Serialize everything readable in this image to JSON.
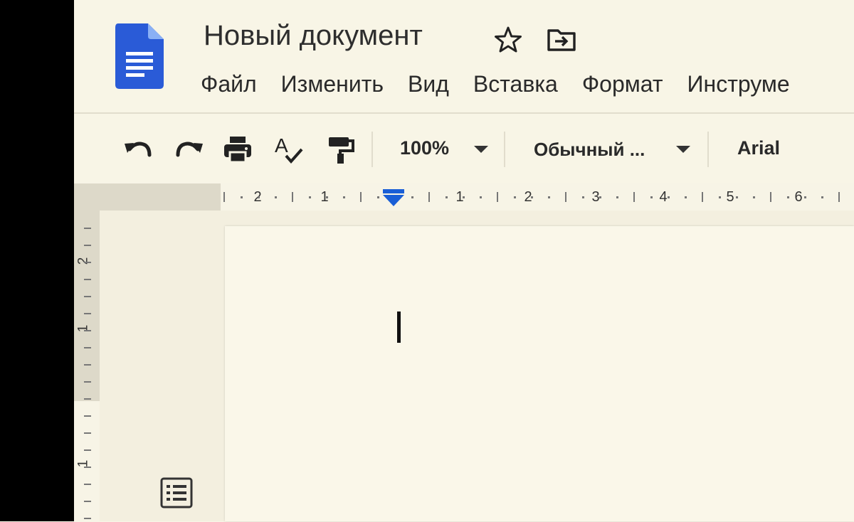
{
  "document": {
    "title": "Новый документ"
  },
  "menu": [
    "Файл",
    "Изменить",
    "Вид",
    "Вставка",
    "Формат",
    "Инструме"
  ],
  "toolbar": {
    "icons": [
      "undo-icon",
      "redo-icon",
      "print-icon",
      "spellcheck-icon",
      "paint-format-icon"
    ],
    "zoom": "100%",
    "style": "Обычный ...",
    "font": "Arial"
  },
  "ruler": {
    "horizontal_labels": [
      "2",
      "1",
      "1",
      "2",
      "3",
      "4",
      "5",
      "6"
    ],
    "vertical_labels": [
      "2",
      "1",
      "1"
    ]
  },
  "colors": {
    "accent": "#1a73e8",
    "docs_blue": "#2a5bd7",
    "background": "#f8f5e6"
  }
}
